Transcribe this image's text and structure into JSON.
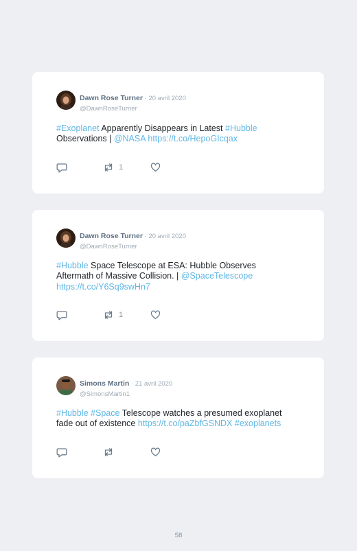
{
  "tweets": [
    {
      "author": "Dawn Rose Turner",
      "separator": " · ",
      "date": "20 avril 2020",
      "handle": "@DawnRoseTurner",
      "avatar_icon": "avatar-photo-woman",
      "text": {
        "t1": "#Exoplanet",
        "t2": " Apparently Disappears in Latest ",
        "t3": "#Hubble",
        "t4": " Observations | ",
        "t5": "@NASA",
        "t6": " ",
        "t7": "https://t.co/HepoGIcqax"
      },
      "retweet_count": "1"
    },
    {
      "author": "Dawn Rose Turner",
      "separator": " · ",
      "date": "20 avril 2020",
      "handle": "@DawnRoseTurner",
      "avatar_icon": "avatar-photo-woman",
      "text": {
        "t1": "#Hubble",
        "t2": " Space Telescope at ESA: Hubble Observes Aftermath of Massive Collision. | ",
        "t3": "@SpaceTelescope",
        "t4": " ",
        "t5": "https://t.co/Y6Sq9swHn7"
      },
      "retweet_count": "1"
    },
    {
      "author": "Simons Martin",
      "separator": " · ",
      "date": "21 avril 2020",
      "handle": "@SimonsMartin1",
      "avatar_icon": "avatar-photo-man",
      "text": {
        "t1": "#Hubble",
        "t2": " ",
        "t3": "#Space",
        "t4": " Telescope watches a presumed exoplanet fade out of existence ",
        "t5": "https://t.co/paZbfGSNDX",
        "t6": " ",
        "t7": "#exoplanets"
      },
      "retweet_count": ""
    }
  ],
  "page_number": "58",
  "icons": [
    "reply-icon",
    "retweet-icon",
    "like-icon"
  ],
  "colors": {
    "link": "#5fb7e5",
    "name": "#5f7185",
    "muted": "#a0aab4",
    "background": "#edeff2"
  }
}
